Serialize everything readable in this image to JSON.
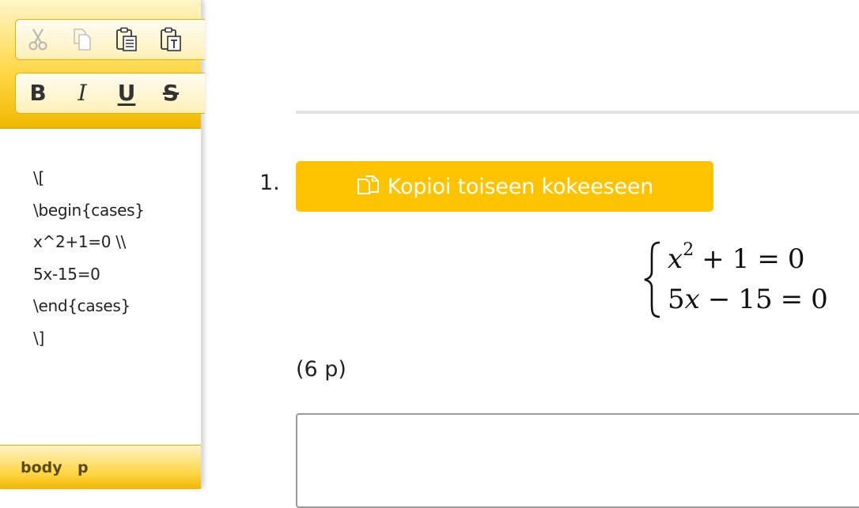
{
  "editor": {
    "toolbar": {
      "clipboard": [
        "scissors-icon",
        "copy-icon",
        "paste-icon",
        "paste-text-icon"
      ],
      "format": {
        "bold": "B",
        "italic": "I",
        "underline": "U",
        "strike": "S"
      }
    },
    "content_lines": [
      "\\[",
      "\\begin{cases}",
      "x^2+1=0 \\\\",
      "5x-15=0",
      "\\end{cases}",
      "\\]"
    ],
    "statusbar": {
      "path": [
        "body",
        "p"
      ]
    }
  },
  "question": {
    "number": "1.",
    "copy_button_label": "Kopioi toiseen kokeeseen",
    "math": {
      "line1": {
        "base": "x",
        "exp": "2",
        "plus": "+",
        "one": "1",
        "eq": "=",
        "rhs": "0"
      },
      "line2": {
        "coef": "5",
        "var": "x",
        "minus": "−",
        "num": "15",
        "eq": "=",
        "rhs": "0"
      }
    },
    "points": "(6 p)"
  },
  "colors": {
    "accent": "#ffc300",
    "toolbar_yellow": "#ffd84a"
  }
}
